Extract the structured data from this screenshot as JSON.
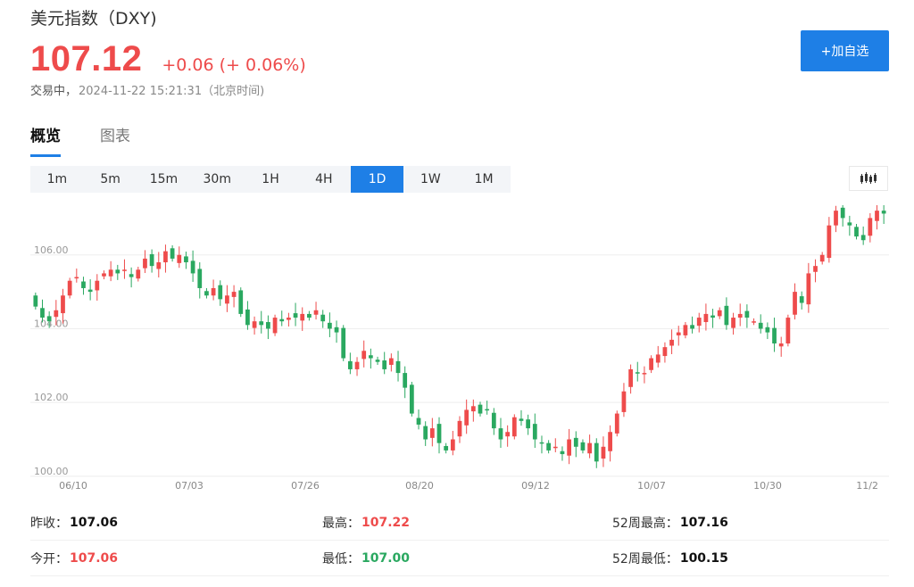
{
  "header": {
    "title": "美元指数（DXY)",
    "price": "107.12",
    "change": "+0.06 (+ 0.06%)",
    "status_label": "交易中，",
    "timestamp": "2024-11-22 15:21:31（北京时间)",
    "add_watchlist_label": "+加自选"
  },
  "tabs": [
    {
      "label": "概览",
      "active": true
    },
    {
      "label": "图表",
      "active": false
    }
  ],
  "intervals": [
    {
      "label": "1m"
    },
    {
      "label": "5m"
    },
    {
      "label": "15m"
    },
    {
      "label": "30m"
    },
    {
      "label": "1H"
    },
    {
      "label": "4H"
    },
    {
      "label": "1D",
      "active": true
    },
    {
      "label": "1W"
    },
    {
      "label": "1M"
    }
  ],
  "colors": {
    "up": "#ee4b4b",
    "down": "#2aa860",
    "accent": "#1e7fe6"
  },
  "chart_data": {
    "type": "candlestick",
    "y_ticks": [
      "106.00",
      "104.00",
      "102.00",
      "100.00"
    ],
    "y_tick_values": [
      106,
      104,
      102,
      100
    ],
    "ylim": [
      99.9,
      107.3
    ],
    "x_ticks": [
      "06/10",
      "07/03",
      "07/26",
      "08/20",
      "09/12",
      "10/07",
      "10/30",
      "11/2"
    ],
    "grid": true,
    "close": [
      104.6,
      104.3,
      104.2,
      104.5,
      104.9,
      105.3,
      105.4,
      105.1,
      105.0,
      105.3,
      105.5,
      105.6,
      105.5,
      105.6,
      105.4,
      105.6,
      105.9,
      105.7,
      105.8,
      106.1,
      105.9,
      106.0,
      105.8,
      105.5,
      105.1,
      104.9,
      105.1,
      104.8,
      104.9,
      105.0,
      104.4,
      104.1,
      104.2,
      104.1,
      104.0,
      104.3,
      104.2,
      104.3,
      104.3,
      104.4,
      104.3,
      104.5,
      104.2,
      104.0,
      103.9,
      103.2,
      102.9,
      103.1,
      103.4,
      103.2,
      103.1,
      102.9,
      103.2,
      102.8,
      102.4,
      101.7,
      101.4,
      101.0,
      101.3,
      100.9,
      100.7,
      101.0,
      101.5,
      101.8,
      101.9,
      101.7,
      101.8,
      101.3,
      101.0,
      101.2,
      101.6,
      101.5,
      101.3,
      101.0,
      100.9,
      100.7,
      100.8,
      100.6,
      101.0,
      100.8,
      100.7,
      100.9,
      100.4,
      100.8,
      101.2,
      101.7,
      102.3,
      102.9,
      102.8,
      102.8,
      103.2,
      103.3,
      103.5,
      103.7,
      103.9,
      104.1,
      104.0,
      104.3,
      104.4,
      104.3,
      104.5,
      104.1,
      104.3,
      104.4,
      104.3,
      104.2,
      104.0,
      103.9,
      103.6,
      103.6,
      104.3,
      105.0,
      104.7,
      105.5,
      105.7,
      106.0,
      106.8,
      107.2,
      107.0,
      106.8,
      106.5,
      106.4,
      107.0,
      107.2,
      107.12
    ]
  },
  "stats": {
    "prev_close_label": "昨收：",
    "prev_close": "107.06",
    "high_label": "最高：",
    "high": "107.22",
    "high52_label": "52周最高：",
    "high52": "107.16",
    "open_label": "今开：",
    "open": "107.06",
    "low_label": "最低：",
    "low": "107.00",
    "low52_label": "52周最低：",
    "low52": "100.15"
  }
}
